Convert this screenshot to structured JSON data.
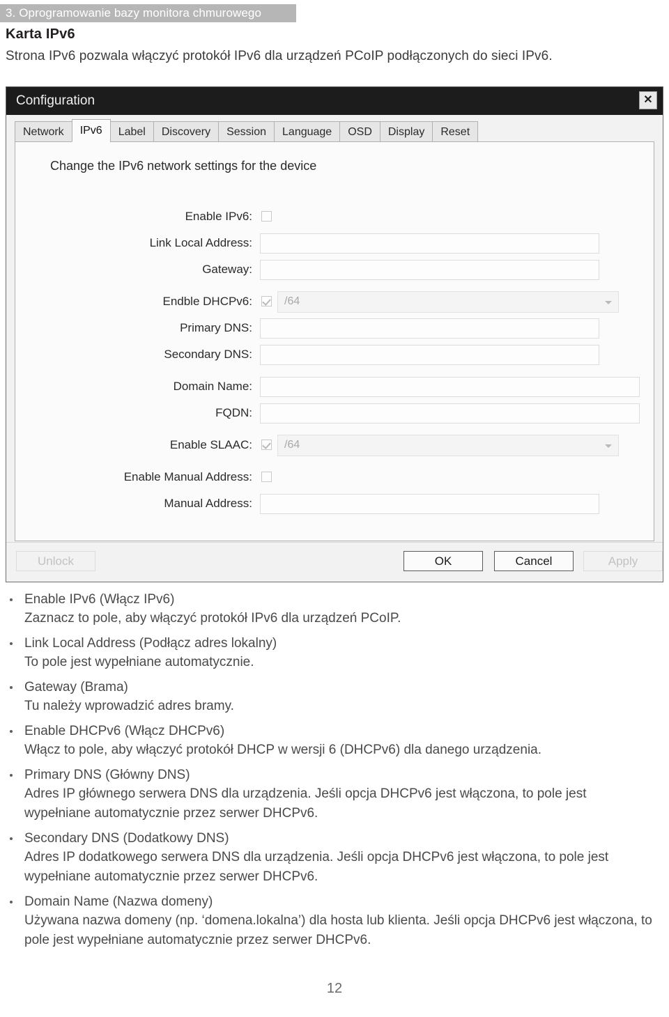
{
  "running_head": "3. Oprogramowanie bazy monitora chmurowego",
  "doc_title": "Karta IPv6",
  "intro": "Strona IPv6 pozwala włączyć protokół IPv6 dla urządzeń PCoIP podłączonych do sieci IPv6.",
  "dialog": {
    "title": "Configuration",
    "close_label": "✕",
    "tabs": [
      {
        "label": "Network",
        "active": false
      },
      {
        "label": "IPv6",
        "active": true
      },
      {
        "label": "Label",
        "active": false
      },
      {
        "label": "Discovery",
        "active": false
      },
      {
        "label": "Session",
        "active": false
      },
      {
        "label": "Language",
        "active": false
      },
      {
        "label": "OSD",
        "active": false
      },
      {
        "label": "Display",
        "active": false
      },
      {
        "label": "Reset",
        "active": false
      }
    ],
    "panel_heading": "Change the IPv6 network settings for the device",
    "fields": [
      {
        "label": "Enable IPv6:",
        "control": "checkbox",
        "checked": false,
        "value": ""
      },
      {
        "label": "Link Local Address:",
        "control": "input",
        "value": "",
        "width": "std"
      },
      {
        "label": "Gateway:",
        "control": "input",
        "value": "",
        "width": "std"
      },
      {
        "label": "Endble DHCPv6:",
        "control": "checkbox-select",
        "checked": true,
        "value": "/64"
      },
      {
        "label": "Primary DNS:",
        "control": "input",
        "value": "",
        "width": "std"
      },
      {
        "label": "Secondary DNS:",
        "control": "input",
        "value": "",
        "width": "std"
      },
      {
        "label": "Domain Name:",
        "control": "input",
        "value": "",
        "width": "wide"
      },
      {
        "label": "FQDN:",
        "control": "input",
        "value": "",
        "width": "wide"
      },
      {
        "label": "Enable SLAAC:",
        "control": "checkbox-select",
        "checked": true,
        "value": "/64"
      },
      {
        "label": "Enable Manual Address:",
        "control": "checkbox",
        "checked": false,
        "value": ""
      },
      {
        "label": "Manual Address:",
        "control": "input",
        "value": "",
        "width": "std"
      }
    ],
    "buttons": {
      "unlock": "Unlock",
      "ok": "OK",
      "cancel": "Cancel",
      "apply": "Apply"
    }
  },
  "bullets": [
    {
      "term": "Enable IPv6 (Włącz IPv6)",
      "desc": "Zaznacz to pole, aby włączyć protokół IPv6 dla urządzeń PCoIP."
    },
    {
      "term": "Link Local Address (Podłącz adres lokalny)",
      "desc": "To pole jest wypełniane automatycznie."
    },
    {
      "term": "Gateway (Brama)",
      "desc": "Tu należy wprowadzić adres bramy."
    },
    {
      "term": "Enable DHCPv6 (Włącz DHCPv6)",
      "desc": "Włącz to pole, aby włączyć protokół DHCP w wersji 6 (DHCPv6) dla danego urządzenia."
    },
    {
      "term": "Primary DNS (Główny DNS)",
      "desc": "Adres IP głównego serwera DNS dla urządzenia. Jeśli opcja DHCPv6 jest włączona, to pole jest wypełniane automatycznie przez serwer DHCPv6."
    },
    {
      "term": "Secondary DNS (Dodatkowy DNS)",
      "desc": "Adres IP dodatkowego serwera DNS dla urządzenia. Jeśli opcja DHCPv6 jest włączona, to pole jest wypełniane automatycznie przez serwer DHCPv6."
    },
    {
      "term": "Domain Name (Nazwa domeny)",
      "desc": "Używana nazwa domeny (np. ‘domena.lokalna’) dla hosta lub klienta. Jeśli opcja DHCPv6 jest włączona, to pole jest wypełniane automatycznie przez serwer DHCPv6."
    }
  ],
  "page_number": "12"
}
